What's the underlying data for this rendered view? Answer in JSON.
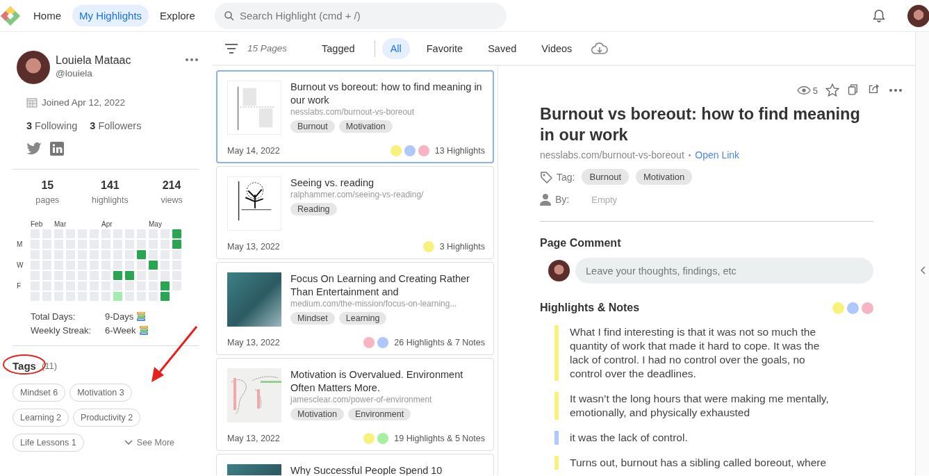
{
  "topbar": {
    "nav": [
      {
        "label": "Home",
        "selected": false
      },
      {
        "label": "My Highlights",
        "selected": true
      },
      {
        "label": "Explore",
        "selected": false
      }
    ],
    "search": {
      "placeholder": "Search Highlight (cmd + /)"
    }
  },
  "profile": {
    "name": "Louiela Mataac",
    "handle": "@louiela",
    "joined": "Joined Apr 12, 2022",
    "following": {
      "count": "3",
      "label": "Following"
    },
    "followers": {
      "count": "3",
      "label": "Followers"
    },
    "stats": [
      {
        "value": "15",
        "label": "pages"
      },
      {
        "value": "141",
        "label": "highlights"
      },
      {
        "value": "214",
        "label": "views"
      }
    ],
    "activity": {
      "day_labels": [
        "M",
        "W",
        "F"
      ],
      "weeks": [
        {
          "month": "Feb",
          "days": [
            {
              "color": "#e9ebee"
            },
            {
              "color": "#e9ebee"
            },
            {
              "color": "#e9ebee"
            },
            {
              "color": "#e9ebee"
            },
            {
              "color": "#e9ebee"
            },
            {
              "color": "#e9ebee"
            },
            {
              "color": "#e9ebee"
            }
          ]
        },
        {
          "days": [
            {
              "color": "#e9ebee"
            },
            {
              "color": "#e9ebee"
            },
            {
              "color": "#e9ebee"
            },
            {
              "color": "#e9ebee"
            },
            {
              "color": "#e9ebee"
            },
            {
              "color": "#e9ebee"
            },
            {
              "color": "#e9ebee"
            }
          ]
        },
        {
          "month": "Mar",
          "days": [
            {
              "color": "#e9ebee"
            },
            {
              "color": "#e9ebee"
            },
            {
              "color": "#e9ebee"
            },
            {
              "color": "#e9ebee"
            },
            {
              "color": "#e9ebee"
            },
            {
              "color": "#e9ebee"
            },
            {
              "color": "#e9ebee"
            }
          ]
        },
        {
          "days": [
            {
              "color": "#e9ebee"
            },
            {
              "color": "#e9ebee"
            },
            {
              "color": "#e9ebee"
            },
            {
              "color": "#e9ebee"
            },
            {
              "color": "#e9ebee"
            },
            {
              "color": "#e9ebee"
            },
            {
              "color": "#e9ebee"
            }
          ]
        },
        {
          "days": [
            {
              "color": "#e9ebee"
            },
            {
              "color": "#e9ebee"
            },
            {
              "color": "#e9ebee"
            },
            {
              "color": "#e9ebee"
            },
            {
              "color": "#e9ebee"
            },
            {
              "color": "#e9ebee"
            },
            {
              "color": "#e9ebee"
            }
          ]
        },
        {
          "days": [
            {
              "color": "#e9ebee"
            },
            {
              "color": "#e9ebee"
            },
            {
              "color": "#e9ebee"
            },
            {
              "color": "#e9ebee"
            },
            {
              "color": "#e9ebee"
            },
            {
              "color": "#e9ebee"
            },
            {
              "color": "#e9ebee"
            }
          ]
        },
        {
          "month": "Apr",
          "days": [
            {
              "color": "#e9ebee"
            },
            {
              "color": "#e9ebee"
            },
            {
              "color": "#e9ebee"
            },
            {
              "color": "#e9ebee"
            },
            {
              "color": "#e9ebee"
            },
            {
              "color": "#e9ebee"
            },
            {
              "color": "#e9ebee"
            }
          ]
        },
        {
          "days": [
            {
              "color": "#e9ebee"
            },
            {
              "color": "#e9ebee"
            },
            {
              "color": "#e9ebee"
            },
            {
              "color": "#e9ebee"
            },
            {
              "color": "#2aa552"
            },
            {
              "color": "#e9ebee"
            },
            {
              "color": "#a3ecb1"
            }
          ]
        },
        {
          "days": [
            {
              "color": "#e9ebee"
            },
            {
              "color": "#e9ebee"
            },
            {
              "color": "#e9ebee"
            },
            {
              "color": "#e9ebee"
            },
            {
              "color": "#2aa552"
            },
            {
              "color": "#e9ebee"
            },
            {
              "color": "#e9ebee"
            }
          ]
        },
        {
          "days": [
            {
              "color": "#e9ebee"
            },
            {
              "color": "#e9ebee"
            },
            {
              "color": "#2aa552"
            },
            {
              "color": "#e9ebee"
            },
            {
              "color": "#e9ebee"
            },
            {
              "color": "#e9ebee"
            },
            {
              "color": "#e9ebee"
            }
          ]
        },
        {
          "month": "May",
          "days": [
            {
              "color": "#e9ebee"
            },
            {
              "color": "#e9ebee"
            },
            {
              "color": "#e9ebee"
            },
            {
              "color": "#2aa552"
            },
            {
              "color": "#e9ebee"
            },
            {
              "color": "#e9ebee"
            },
            {
              "color": "#e9ebee"
            }
          ]
        },
        {
          "days": [
            {
              "color": "#e9ebee"
            },
            {
              "color": "#e9ebee"
            },
            {
              "color": "#e9ebee"
            },
            {
              "color": "#e9ebee"
            },
            {
              "color": "#e9ebee"
            },
            {
              "color": "#2aa552"
            },
            {
              "color": "#2aa552"
            }
          ]
        },
        {
          "days": [
            {
              "color": "#2aa552"
            },
            {
              "color": "#2aa552"
            },
            {
              "color": "#e9ebee"
            },
            {
              "color": "#e9ebee"
            },
            {
              "color": "#e9ebee"
            },
            {
              "color": "#e9ebee"
            }
          ]
        }
      ]
    },
    "streaks": [
      {
        "label": "Total Days:",
        "value": "9-Days"
      },
      {
        "label": "Weekly Streak:",
        "value": "6-Week"
      }
    ],
    "tags_title": "Tags",
    "tags_count": "(11)",
    "tags": [
      {
        "label": "Mindset 6"
      },
      {
        "label": "Motivation 3"
      },
      {
        "label": "Learning 2"
      },
      {
        "label": "Productivity 2"
      },
      {
        "label": "Life Lessons 1"
      }
    ],
    "see_more": "See More"
  },
  "annotations": [
    {
      "kind": "ellipse"
    },
    {
      "kind": "arrow"
    }
  ],
  "filter_bar": {
    "count": "15 Pages",
    "tabs": [
      {
        "label": "Tagged",
        "selected": false
      },
      {
        "label": "All",
        "selected": true
      },
      {
        "label": "Favorite",
        "selected": false
      },
      {
        "label": "Saved",
        "selected": false
      },
      {
        "label": "Videos",
        "selected": false
      }
    ]
  },
  "pages": [
    {
      "thumbnail": {
        "kind": "chart"
      },
      "title": "Burnout vs boreout: how to find meaning in our work",
      "url": "nesslabs.com/burnout-vs-boreout",
      "tags": [
        "Burnout",
        "Motivation"
      ],
      "date": "May 14, 2022",
      "dots": [
        {
          "color": "#f7f27e"
        },
        {
          "color": "#aec8fb"
        },
        {
          "color": "#f9b4c3"
        }
      ],
      "count": "13 Highlights",
      "selected": true
    },
    {
      "thumbnail": {
        "kind": "tree"
      },
      "title": "Seeing vs. reading",
      "url": "ralphammer.com/seeing-vs-reading/",
      "tags": [
        "Reading"
      ],
      "date": "May 13, 2022",
      "dots": [
        {
          "color": "#f7f27e"
        }
      ],
      "count": "3 Highlights",
      "selected": false
    },
    {
      "thumbnail": {
        "kind": "photo"
      },
      "title": "Focus On Learning and Creating Rather Than Entertainment and",
      "url": "medium.com/the-mission/focus-on-learning...",
      "tags": [
        "Mindset",
        "Learning"
      ],
      "date": "May 13, 2022",
      "dots": [
        {
          "color": "#f9b4c3"
        },
        {
          "color": "#aec8fb"
        }
      ],
      "count": "26 Highlights & 7 Notes",
      "selected": false
    },
    {
      "thumbnail": {
        "kind": "map"
      },
      "title": "Motivation is Overvalued. Environment Often Matters More.",
      "url": "jamesclear.com/power-of-environment",
      "tags": [
        "Motivation",
        "Environment"
      ],
      "date": "May 13, 2022",
      "dots": [
        {
          "color": "#f7f27e"
        },
        {
          "color": "#a2f0a0"
        }
      ],
      "count": "19 Highlights & 5 Notes",
      "selected": false
    },
    {
      "thumbnail": {
        "kind": "photo"
      },
      "title": "Why Successful People Spend 10",
      "selected": false
    }
  ],
  "detail": {
    "views": "5",
    "title": "Burnout vs boreout: how to find meaning in our work",
    "url": "nesslabs.com/burnout-vs-boreout",
    "separator": "•",
    "open_link": "Open Link",
    "tag_label": "Tag:",
    "tags": [
      "Burnout",
      "Motivation"
    ],
    "by_label": "By:",
    "by_value": "Empty",
    "comment_heading": "Page Comment",
    "comment": {
      "placeholder": "Leave your thoughts, findings, etc"
    },
    "highlights_heading": "Highlights & Notes",
    "filter_dots": [
      {
        "color": "#f7f27e"
      },
      {
        "color": "#aec8fb"
      },
      {
        "color": "#f9b4c3"
      }
    ],
    "highlights": [
      {
        "text": "What I find interesting is that it was not so much the quantity of work that made it hard to cope. It was the lack of control. I had no control over the goals, no control over the deadlines.",
        "color": "#f7f27e"
      },
      {
        "text": "It wasn’t the long hours that were making me mentally, emotionally, and physically exhausted",
        "color": "#f7f27e"
      },
      {
        "text": "it was the lack of control.",
        "color": "#aec8fb"
      },
      {
        "text": "Turns out, burnout has a sibling called boreout, where",
        "color": "#f7f27e"
      }
    ]
  }
}
